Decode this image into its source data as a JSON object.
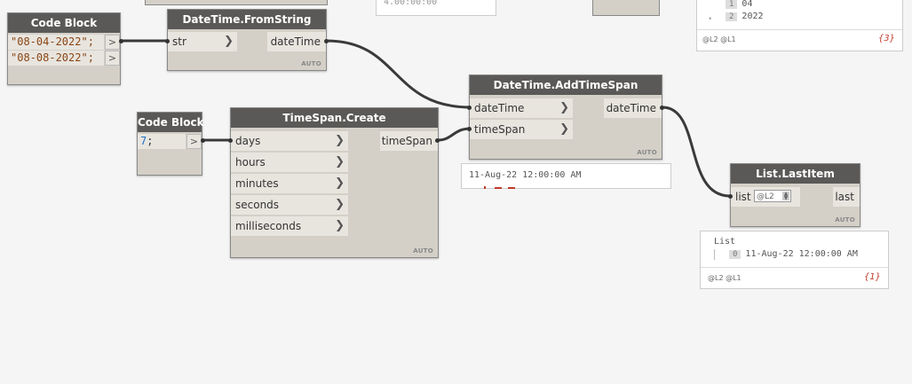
{
  "partial_top": {
    "preview_mid_text": "4.00:00:00",
    "preview_right_items": [
      {
        "index": "1",
        "value": "04"
      },
      {
        "index": "2",
        "value": "2022"
      }
    ],
    "preview_right_levels": "@L2 @L1",
    "preview_right_count": "{3}"
  },
  "code_block_dates": {
    "title": "Code Block",
    "lines": [
      "\"08-04-2022\";",
      "\"08-08-2022\";"
    ],
    "out_symbol": ">"
  },
  "datetime_fromstring": {
    "title": "DateTime.FromString",
    "input": "str",
    "output": "dateTime",
    "lacing": "AUTO"
  },
  "code_block_seven": {
    "title": "Code Block",
    "number": "7",
    "suffix": ";",
    "out_symbol": ">"
  },
  "timespan_create": {
    "title": "TimeSpan.Create",
    "inputs": [
      "days",
      "hours",
      "minutes",
      "seconds",
      "milliseconds"
    ],
    "output": "timeSpan",
    "lacing": "AUTO"
  },
  "datetime_addtimespan": {
    "title": "DateTime.AddTimeSpan",
    "inputs": [
      "dateTime",
      "timeSpan"
    ],
    "output": "dateTime",
    "lacing": "AUTO",
    "preview": "11-Aug-22 12:00:00 AM"
  },
  "list_lastitem": {
    "title": "List.LastItem",
    "input": "list",
    "level": "@L2",
    "output": "last",
    "lacing": "AUTO",
    "preview_header": "List",
    "preview_index": "0",
    "preview_value": "11-Aug-22 12:00:00 AM",
    "preview_levels": "@L2 @L1",
    "preview_count": "{1}"
  },
  "colors": {
    "canvas": "#f5f5f5",
    "node_header": "#5b5957",
    "node_body": "#d4d0c8",
    "wire": "#3a3a3a",
    "code_string": "#8b4513",
    "code_number": "#1f6fc5",
    "count": "#c0392b"
  }
}
